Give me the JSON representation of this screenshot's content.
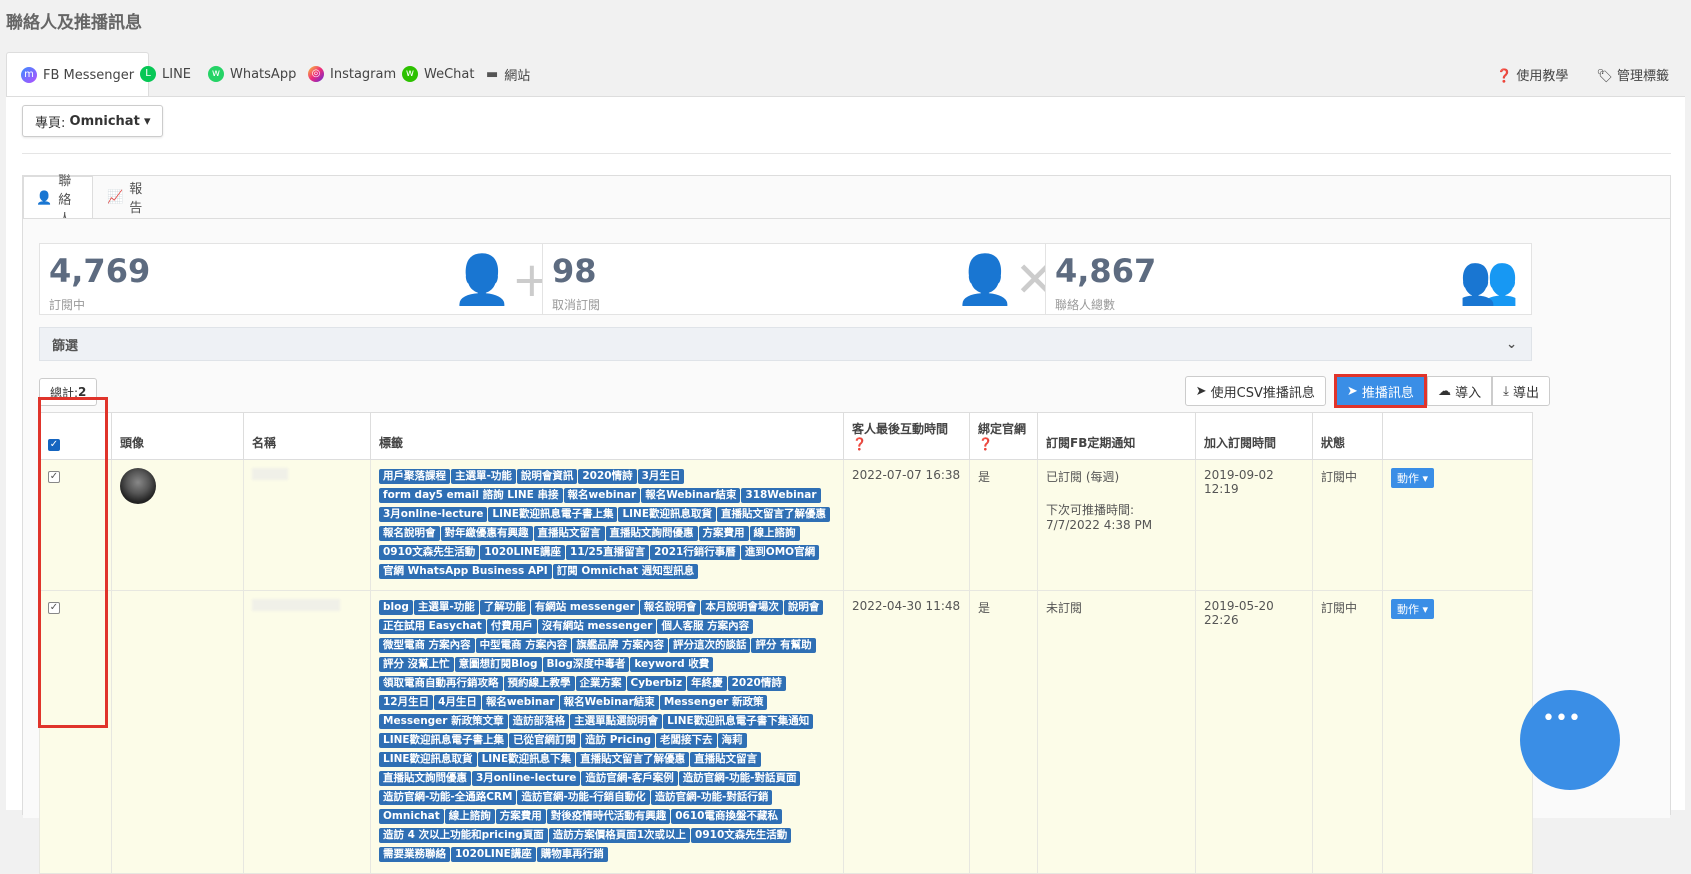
{
  "page_title": "聯絡人及推播訊息",
  "channels": [
    {
      "label": "FB Messenger",
      "icon": "messenger-icon"
    },
    {
      "label": "LINE",
      "icon": "line-icon"
    },
    {
      "label": "WhatsApp",
      "icon": "whatsapp-icon"
    },
    {
      "label": "Instagram",
      "icon": "instagram-icon"
    },
    {
      "label": "WeChat",
      "icon": "wechat-icon"
    },
    {
      "label": "網站",
      "icon": "chat-icon"
    }
  ],
  "header_links": {
    "help": "使用教學",
    "tags": "管理標籤"
  },
  "page_select": {
    "prefix": "專頁: ",
    "value": "Omnichat"
  },
  "inner_tabs": {
    "contacts": "聯絡人",
    "report": "報告"
  },
  "stats": [
    {
      "value": "4,769",
      "label": "訂閱中",
      "icon": "user-plus-icon"
    },
    {
      "value": "98",
      "label": "取消訂閱",
      "icon": "user-times-icon"
    },
    {
      "value": "4,867",
      "label": "聯絡人總數",
      "icon": "users-icon"
    }
  ],
  "filter_label": "篩選",
  "total": {
    "label": "總計: ",
    "value": "2"
  },
  "toolbar": {
    "csv": "使用CSV推播訊息",
    "broadcast": "推播訊息",
    "import": "導入",
    "export": "導出"
  },
  "table": {
    "headers": {
      "avatar": "頭像",
      "name": "名稱",
      "tags": "標籤",
      "last_interaction": "客人最後互動時間",
      "bound": "綁定官網",
      "fb_sub": "訂閱FB定期通知",
      "joined": "加入訂閱時間",
      "status": "狀態"
    },
    "rows": [
      {
        "tags": [
          "用戶聚落課程",
          "主選單-功能",
          "說明會資訊",
          "2020情詩",
          "3月生日",
          "form day5 email 諮詢 LINE 串接",
          "報名webinar",
          "報名Webinar結束",
          "318Webinar",
          "3月online-lecture",
          "LINE歡迎訊息電子書上集",
          "LINE歡迎訊息取貨",
          "直播貼文留言了解優惠",
          "報名說明會",
          "對年繳優惠有興趣",
          "直播貼文留言",
          "直播貼文詢問優惠",
          "方案費用",
          "線上諮詢",
          "0910文森先生活動",
          "1020LINE講座",
          "11/25直播留言",
          "2021行銷行事曆",
          "進到OMO官網",
          "官網 WhatsApp Business API",
          "訂閱 Omnichat 週知型訊息"
        ],
        "last": "2022-07-07 16:38",
        "bound": "是",
        "fb_sub": "已訂閱 (每週)",
        "fb_next": "下次可推播時間: 7/7/2022 4:38 PM",
        "joined": "2019-09-02 12:19",
        "status": "訂閱中",
        "action": "動作"
      },
      {
        "tags": [
          "blog",
          "主選單-功能",
          "了解功能",
          "有網站 messenger",
          "報名說明會",
          "本月說明會場次",
          "說明會",
          "正在試用 Easychat",
          "付費用戶",
          "沒有網站 messenger",
          "個人客服 方案內容",
          "微型電商 方案內容",
          "中型電商 方案內容",
          "旗艦品牌 方案內容",
          "評分這次的談話",
          "評分 有幫助",
          "評分 沒幫上忙",
          "意圖想訂閱Blog",
          "Blog深度中毒者",
          "keyword 收費",
          "領取電商自動再行銷攻略",
          "預約線上教學",
          "企業方案",
          "Cyberbiz",
          "年終慶",
          "2020情詩",
          "12月生日",
          "4月生日",
          "報名webinar",
          "報名Webinar結束",
          "Messenger 新政策",
          "Messenger 新政策文章",
          "造訪部落格",
          "主選單點選說明會",
          "LINE歡迎訊息電子書下集通知",
          "LINE歡迎訊息電子書上集",
          "已從官網訂閱",
          "造訪 Pricing",
          "老闆接下去",
          "海莉",
          "LINE歡迎訊息取貨",
          "LINE歡迎訊息下集",
          "直播貼文留言了解優惠",
          "直播貼文留言",
          "直播貼文詢問優惠",
          "3月online-lecture",
          "造訪官網-客戶案例",
          "造訪官網-功能-對話頁面",
          "造訪官網-功能-全通路CRM",
          "造訪官網-功能-行銷自動化",
          "造訪官網-功能-對話行銷",
          "Omnichat",
          "線上諮詢",
          "方案費用",
          "對後疫情時代活動有興趣",
          "0610電商換盤不藏私",
          "造訪 4 次以上功能和pricing頁面",
          "造訪方案價格頁面1次或以上",
          "0910文森先生活動",
          "需要業務聯絡",
          "1020LINE講座",
          "購物車再行銷"
        ],
        "last": "2022-04-30 11:48",
        "bound": "是",
        "fb_sub": "未訂閱",
        "fb_next": "",
        "joined": "2019-05-20 22:26",
        "status": "訂閱中",
        "action": "動作"
      }
    ]
  }
}
